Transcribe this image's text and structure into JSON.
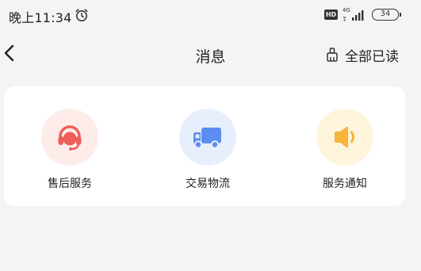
{
  "status_bar": {
    "time": "晚上11:34",
    "hd_badge": "HD",
    "network": "4G",
    "battery_level": "34"
  },
  "nav": {
    "title": "消息",
    "read_all_label": "全部已读"
  },
  "categories": [
    {
      "label": "售后服务",
      "icon": "headset-icon",
      "bg_color": "#fdecea",
      "icon_color": "#ee5f57"
    },
    {
      "label": "交易物流",
      "icon": "truck-icon",
      "bg_color": "#e8effc",
      "icon_color": "#5b8ef0"
    },
    {
      "label": "服务通知",
      "icon": "speaker-icon",
      "bg_color": "#fff5dc",
      "icon_color": "#f7b53a"
    }
  ]
}
